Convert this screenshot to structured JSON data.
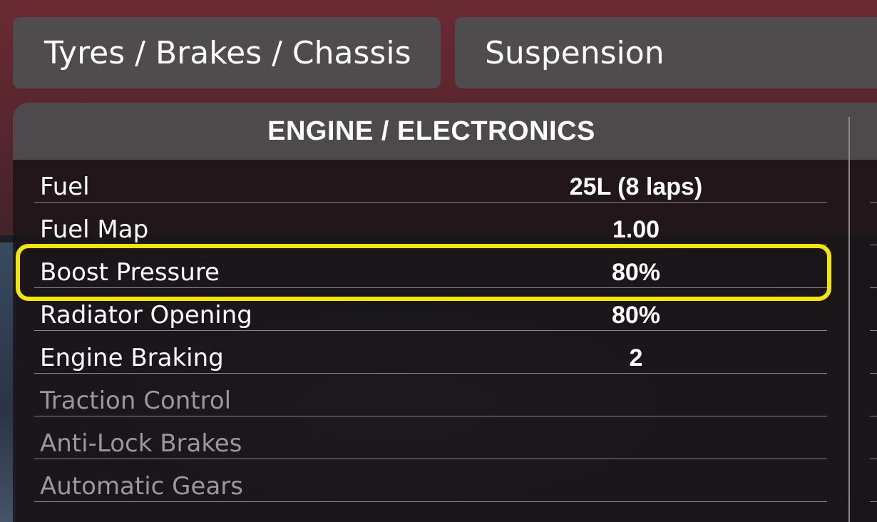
{
  "tabs": {
    "tyres_label": "Tyres / Brakes / Chassis",
    "suspension_label": "Suspension"
  },
  "panel": {
    "title": "ENGINE / ELECTRONICS",
    "rows": [
      {
        "label": "Fuel",
        "value": "25L  (8 laps)",
        "enabled": true
      },
      {
        "label": "Fuel Map",
        "value": "1.00",
        "enabled": true
      },
      {
        "label": "Boost Pressure",
        "value": "80%",
        "enabled": true,
        "highlighted": true
      },
      {
        "label": "Radiator Opening",
        "value": "80%",
        "enabled": true
      },
      {
        "label": "Engine Braking",
        "value": "2",
        "enabled": true
      },
      {
        "label": "Traction Control",
        "value": "",
        "enabled": false
      },
      {
        "label": "Anti-Lock Brakes",
        "value": "",
        "enabled": false
      },
      {
        "label": "Automatic Gears",
        "value": "",
        "enabled": false
      }
    ]
  },
  "colors": {
    "highlight": "#f3e600",
    "disabled_text": "#9a9898"
  }
}
